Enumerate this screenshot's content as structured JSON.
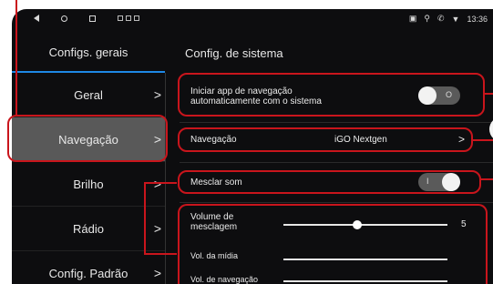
{
  "statusbar": {
    "time": "13:36"
  },
  "header": {
    "left_tab": "Configs. gerais",
    "right_title": "Config. de sistema"
  },
  "sidebar": {
    "items": [
      {
        "label": "Geral",
        "chevron": ">"
      },
      {
        "label": "Navegação",
        "chevron": ">"
      },
      {
        "label": "Brilho",
        "chevron": ">"
      },
      {
        "label": "Rádio",
        "chevron": ">"
      },
      {
        "label": "Config. Padrão",
        "chevron": ">"
      }
    ]
  },
  "settings": {
    "auto_start": {
      "label": "Iniciar app de navegação automaticamente com o sistema",
      "state": "off",
      "off_mark": "O"
    },
    "navigation": {
      "label": "Navegação",
      "value": "iGO Nextgen",
      "chevron": ">"
    },
    "mix_sound": {
      "label": "Mesclar som",
      "state": "on",
      "on_mark": "I"
    },
    "mix_volume": {
      "label": "Volume de mesclagem",
      "value": "5",
      "level": 0.45
    },
    "media_volume": {
      "label": "Vol. da mídia"
    },
    "nav_volume": {
      "label": "Vol. de navegação"
    }
  },
  "colors": {
    "background": "#0d0d0f",
    "active_item": "#595959",
    "highlight": "#c9151c",
    "accent": "#1e88e5"
  }
}
